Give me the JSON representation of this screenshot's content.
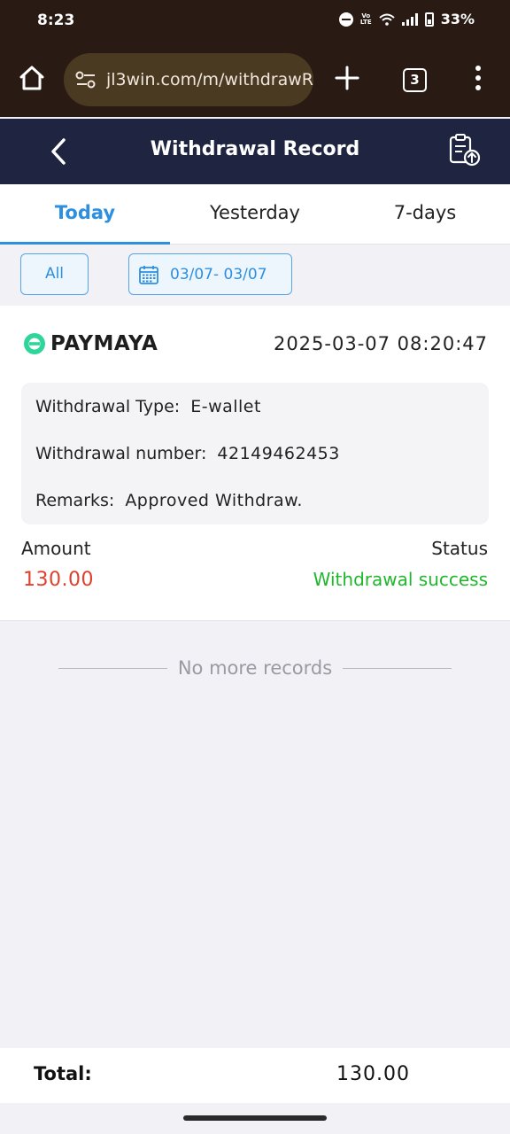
{
  "status_bar": {
    "time": "8:23",
    "battery": "33%",
    "network": "VoLTE"
  },
  "browser": {
    "url": "jl3win.com/m/withdrawR",
    "tab_count": "3"
  },
  "header": {
    "title": "Withdrawal Record"
  },
  "tabs": [
    {
      "label": "Today",
      "active": true
    },
    {
      "label": "Yesterday",
      "active": false
    },
    {
      "label": "7-days",
      "active": false
    }
  ],
  "filters": {
    "type": "All",
    "date_range": "03/07- 03/07"
  },
  "record": {
    "provider": "PAYMAYA",
    "datetime": "2025-03-07 08:20:47",
    "type_label": "Withdrawal Type:",
    "type_value": "E-wallet",
    "number_label": "Withdrawal number:",
    "number_value": "42149462453",
    "remarks_label": "Remarks:",
    "remarks_value": "Approved Withdraw.",
    "amount_label": "Amount",
    "amount_value": "130.00",
    "status_label": "Status",
    "status_value": "Withdrawal success"
  },
  "list_end": "No more records",
  "footer": {
    "total_label": "Total:",
    "total_value": "130.00"
  },
  "colors": {
    "accent": "#2c8fe0",
    "header_bg": "#1f2540",
    "amount": "#e0402c",
    "success": "#1fb82c",
    "paymaya_brand": "#2fd69a"
  }
}
